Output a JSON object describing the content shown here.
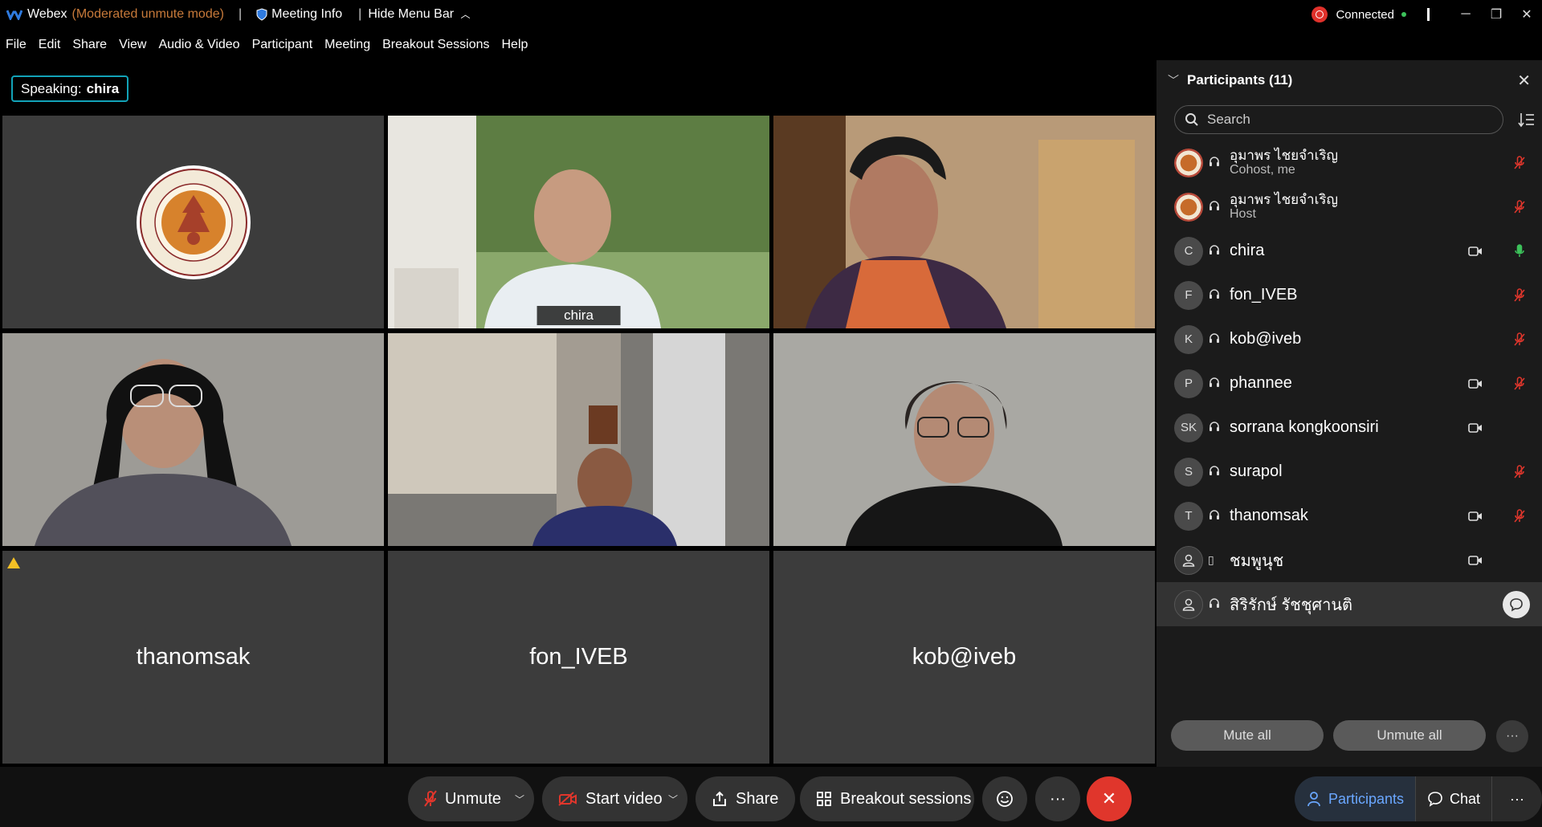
{
  "titlebar": {
    "app": "Webex",
    "mode": "(Moderated unmute mode)",
    "meeting_info": "Meeting Info",
    "hide_menu": "Hide Menu Bar",
    "status": "Connected"
  },
  "menu": [
    "File",
    "Edit",
    "Share",
    "View",
    "Audio & Video",
    "Participant",
    "Meeting",
    "Breakout Sessions",
    "Help"
  ],
  "speaking": {
    "label": "Speaking:",
    "name": "chira"
  },
  "tiles": {
    "chira_label": "chira",
    "thanomsak": "thanomsak",
    "fon": "fon_IVEB",
    "kob": "kob@iveb"
  },
  "panel": {
    "title": "Participants (11)",
    "search_placeholder": "Search",
    "participants": [
      {
        "name": "อุมาพร ไชยจำเริญ",
        "sub": "Cohost, me",
        "avatar": "",
        "cam": false,
        "mic": "muted"
      },
      {
        "name": "อุมาพร ไชยจำเริญ",
        "sub": "Host",
        "avatar": "",
        "cam": false,
        "mic": "muted"
      },
      {
        "name": "chira",
        "sub": "",
        "avatar": "C",
        "cam": true,
        "mic": "active"
      },
      {
        "name": "fon_IVEB",
        "sub": "",
        "avatar": "F",
        "cam": false,
        "mic": "muted"
      },
      {
        "name": "kob@iveb",
        "sub": "",
        "avatar": "K",
        "cam": false,
        "mic": "muted"
      },
      {
        "name": "phannee",
        "sub": "",
        "avatar": "P",
        "cam": true,
        "mic": "muted"
      },
      {
        "name": "sorrana kongkoonsiri",
        "sub": "",
        "avatar": "SK",
        "cam": true,
        "mic": "none"
      },
      {
        "name": "surapol",
        "sub": "",
        "avatar": "S",
        "cam": false,
        "mic": "muted"
      },
      {
        "name": "thanomsak",
        "sub": "",
        "avatar": "T",
        "cam": true,
        "mic": "muted"
      },
      {
        "name": "ชมพูนุช",
        "sub": "",
        "avatar": "",
        "cam": true,
        "mic": "none"
      },
      {
        "name": "สิริรักษ์ รัชชุศานติ",
        "sub": "",
        "avatar": "",
        "cam": false,
        "mic": "none"
      }
    ],
    "mute_all": "Mute all",
    "unmute_all": "Unmute all"
  },
  "toolbar": {
    "unmute": "Unmute",
    "start_video": "Start video",
    "share": "Share",
    "breakout": "Breakout sessions",
    "participants": "Participants",
    "chat": "Chat"
  },
  "colors": {
    "accent": "#2bb4e0",
    "end_call": "#e0362c",
    "muted_red": "#e0362c",
    "mic_green": "#3cc15a",
    "mode_orange": "#c87a3a"
  }
}
